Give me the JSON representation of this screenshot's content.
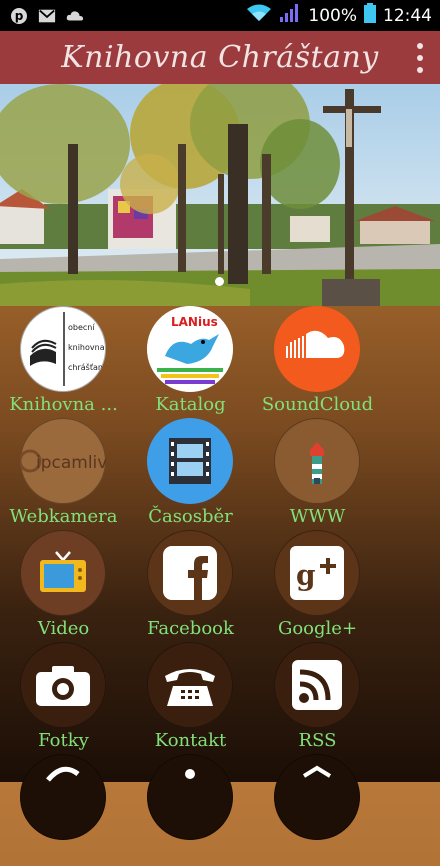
{
  "status_bar": {
    "battery": "100%",
    "time": "12:44",
    "icons": [
      "pinterest-icon",
      "gmail-icon",
      "cloud-icon",
      "wifi-icon",
      "signal-icon",
      "battery-icon"
    ]
  },
  "app_bar": {
    "title": "Knihovna Chráštany",
    "menu_icon": "overflow-menu-icon",
    "color": "#9c3b3d"
  },
  "hero": {
    "image": "village-park-with-crucifix-photo",
    "page_indicator": {
      "current": 1
    }
  },
  "tiles": [
    {
      "label": "Knihovna ...",
      "icon": "library-logo-icon"
    },
    {
      "label": "Katalog",
      "icon": "lanius-bird-icon"
    },
    {
      "label": "SoundCloud",
      "icon": "soundcloud-icon"
    },
    {
      "label": "Webkamera",
      "icon": "ipcamlive-icon"
    },
    {
      "label": "Časosběr",
      "icon": "film-strip-icon"
    },
    {
      "label": "WWW",
      "icon": "lighthouse-icon"
    },
    {
      "label": "Video",
      "icon": "tv-icon"
    },
    {
      "label": "Facebook",
      "icon": "facebook-icon"
    },
    {
      "label": "Google+",
      "icon": "google-plus-icon"
    },
    {
      "label": "Fotky",
      "icon": "camera-icon"
    },
    {
      "label": "Kontakt",
      "icon": "phone-icon"
    },
    {
      "label": "RSS",
      "icon": "rss-icon"
    }
  ],
  "logo_text": [
    "obecní",
    "knihovna",
    "chrášťany"
  ],
  "katalog_logo_text": "LANius",
  "webcam_logo_text": "ipcamlive",
  "colors": {
    "label": "#82e07a",
    "soundcloud": "#f25a1e"
  }
}
